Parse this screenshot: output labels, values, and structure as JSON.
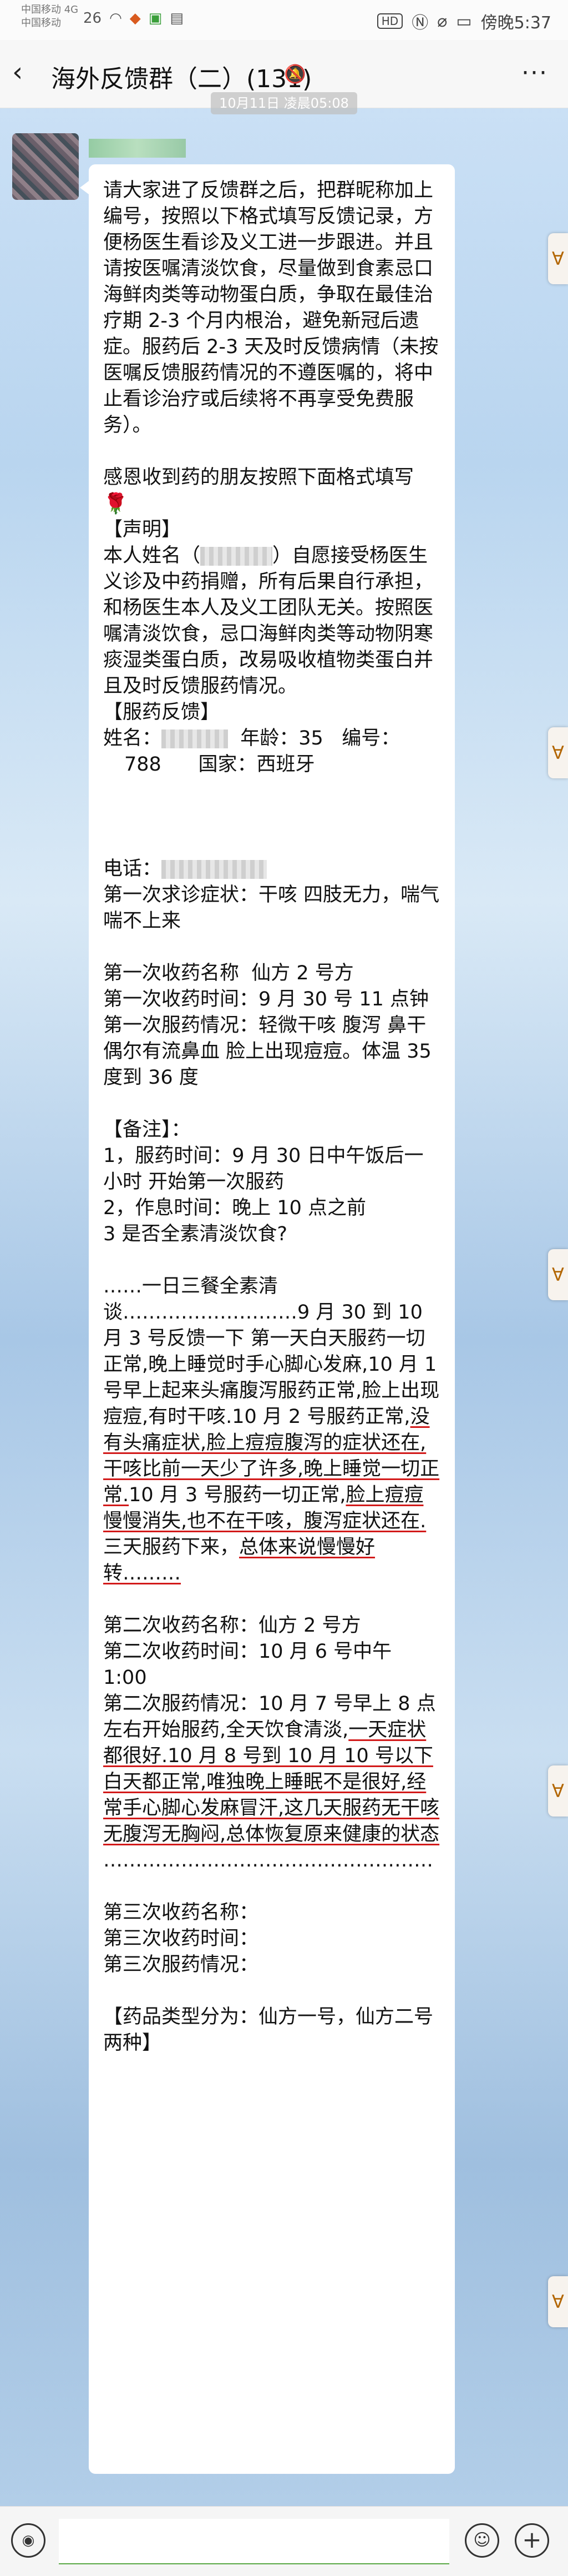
{
  "status": {
    "carrier_1": "中国移动 4G",
    "carrier_2": "中国移动",
    "signal_text": "26",
    "hd_label": "HD",
    "battery_label": "傍晚5:37"
  },
  "header": {
    "title": "海外反馈群（二）(131)",
    "more_label": "···",
    "back_label": "‹"
  },
  "chat": {
    "timestamp": "10月11日 凌晨05:08"
  },
  "message": {
    "p1": "请大家进了反馈群之后，把群昵称加上编号，按照以下格式填写反馈记录，方便杨医生看诊及义工进一步跟进。并且请按医嘱清淡饮食，尽量做到食素忌口海鲜肉类等动物蛋白质，争取在最佳治疗期 2-3 个月内根治，避免新冠后遗症。服药后 2-3 天及时反馈病情（未按医嘱反馈服药情况的不遵医嘱的，将中止看诊治疗或后续将不再享受免费服务）。",
    "p2": "感恩收到药的朋友按照下面格式填写",
    "declaration_head": "【声明】",
    "declaration_a": "本人姓名（",
    "declaration_b": "）自愿接受杨医生义诊及中药捐赠，所有后果自行承担，和杨医生本人及义工团队无关。按照医嘱清淡饮食，忌口海鲜肉类等动物阴寒痰湿类蛋白质，改易吸收植物类蛋白并且及时反馈服药情况。",
    "feedback_head": "【服药反馈】",
    "name_label": "姓名：",
    "age_text": "年龄：35",
    "id_label": "编号：",
    "id_and_country": "788      国家：西班牙",
    "phone_label": "电话：",
    "first_symptom": "第一次求诊症状：干咳 四肢无力，喘气喘不上来",
    "first_med_name": "第一次收药名称  仙方 2 号方",
    "first_med_time": "第一次收药时间：9 月 30 号 11 点钟",
    "first_med_status": "第一次服药情况：轻微干咳 腹泻 鼻干偶尔有流鼻血 脸上出现痘痘。体温 35 度到 36 度",
    "notes_head": "【备注】：",
    "note_1": "1，服药时间：9 月 30 日中午饭后一小时 开始第一次服药",
    "note_2": "2，作息时间：晚上 10 点之前",
    "note_3": "3 是否全素清淡饮食?",
    "diet_1": "……一日三餐全素清",
    "diet_2a": "谈………………………9 月 30 到 10 月 3 号反馈一下 第一天白天服药一切正常,晚上睡觉时手心脚心发麻,10 月 1 号早上起来头痛腹泻服药正常,脸上出现痘痘,有时干咳.10 月 2 号服药正常,",
    "diet_2b": "没有头痛症状,脸上痘痘腹泻的症状还在,干咳比前一天少了许多,晚上睡觉一切正常.",
    "diet_2c": "10 月 3 号服药一切正常,",
    "diet_2d": "脸上痘痘慢慢消失,也不在干咳，腹泻症状还在.",
    "diet_2e": "三天服药下来，",
    "diet_2f": "总体来说慢慢好转………",
    "second_med_name": "第二次收药名称：仙方 2 号方",
    "second_med_time": "第二次收药时间：10 月 6 号中午 1:00",
    "second_med_status_a": "第二次服药情况：10 月 7 号早上 8 点左右开始服药,全天饮食清淡,",
    "second_med_status_b": "一天症状都很好.10 月 8 号到 10 月 10 号以下白天都正常,唯独晚上睡眠不是很好,经常手心脚心发麻冒汗,这几天服药无干咳无腹泻无胸闷,总体恢复原来健康的状态",
    "divider": "……………………………………………",
    "third_med_name": "第三次收药名称：",
    "third_med_time": "第三次收药时间：",
    "third_med_status": "第三次服药情况：",
    "drug_types": "【药品类型分为：仙方一号，仙方二号  两种】"
  },
  "input": {
    "placeholder": ""
  }
}
